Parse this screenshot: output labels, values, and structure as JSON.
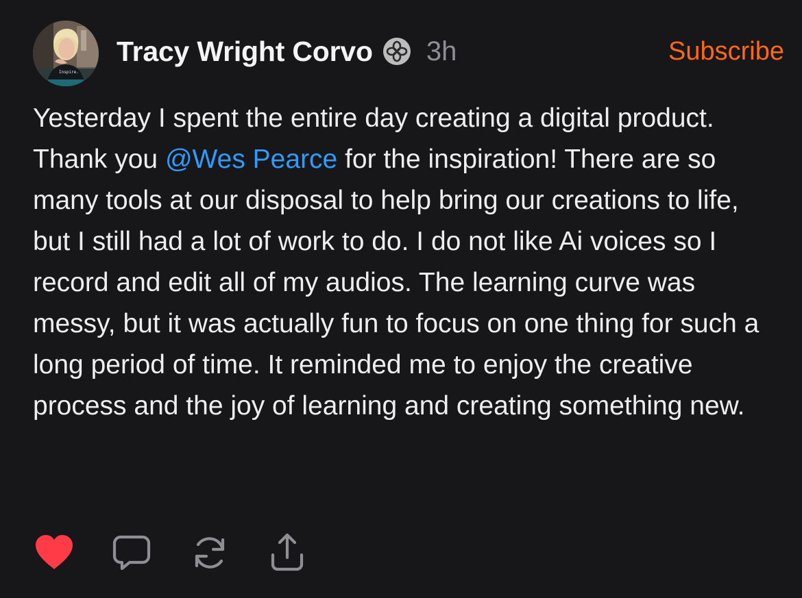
{
  "colors": {
    "background": "#17171a",
    "text": "#eeeeee",
    "muted": "#8e8e93",
    "subscribe": "#ff6719",
    "mention": "#2f9bff",
    "like": "#ff3b47"
  },
  "author": {
    "name": "Tracy Wright Corvo",
    "avatar_shirt_text": "Inspire.",
    "badge_icon": "flower-badge-icon",
    "timestamp": "3h"
  },
  "subscribe_label": "Subscribe",
  "post": {
    "text_before_mention": "Yesterday I spent the entire day creating a digital product. Thank you ",
    "mention": "@Wes Pearce",
    "text_after_mention": " for the inspiration! There are so many tools at our disposal to help bring our creations to life, but I still had a lot of work to do. I do not like Ai voices so I record and edit all of my audios. The learning curve was messy, but it was actually fun to focus on one thing for such a long period of time. It reminded me to enjoy the creative process and the joy of learning and creating something new."
  },
  "actions": [
    {
      "icon": "heart-icon",
      "state": "liked"
    },
    {
      "icon": "comment-icon"
    },
    {
      "icon": "restack-icon"
    },
    {
      "icon": "share-icon"
    }
  ]
}
